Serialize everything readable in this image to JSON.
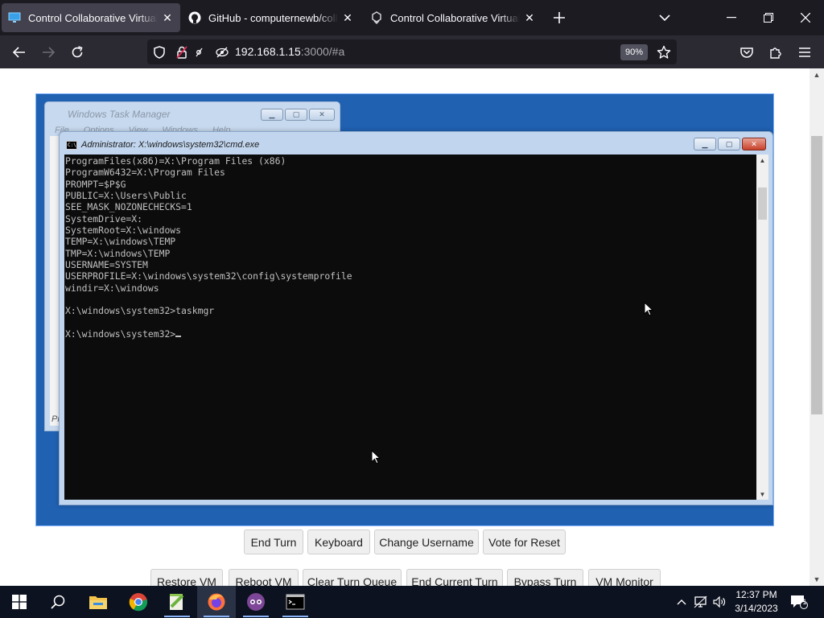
{
  "browser": {
    "tabs": [
      {
        "title": "Control Collaborative Virtual Machine",
        "icon": "monitor-icon",
        "active": true
      },
      {
        "title": "GitHub - computernewb/collab-vm",
        "icon": "github-icon",
        "active": false
      },
      {
        "title": "Control Collaborative Virtual Machine",
        "icon": "tab-extension-icon",
        "active": false
      }
    ],
    "url_host": "192.168.1.15",
    "url_path": ":3000/#a",
    "zoom": "90%"
  },
  "vm": {
    "task_manager": {
      "title": "Windows Task Manager",
      "menu": [
        "File",
        "Options",
        "View",
        "Windows",
        "Help"
      ],
      "status_fragment": "Pr"
    },
    "cmd": {
      "title": "Administrator: X:\\windows\\system32\\cmd.exe",
      "lines": [
        "ProgramFiles(x86)=X:\\Program Files (x86)",
        "ProgramW6432=X:\\Program Files",
        "PROMPT=$P$G",
        "PUBLIC=X:\\Users\\Public",
        "SEE_MASK_NOZONECHECKS=1",
        "SystemDrive=X:",
        "SystemRoot=X:\\windows",
        "TEMP=X:\\windows\\TEMP",
        "TMP=X:\\windows\\TEMP",
        "USERNAME=SYSTEM",
        "USERPROFILE=X:\\windows\\system32\\config\\systemprofile",
        "windir=X:\\windows",
        "",
        "X:\\windows\\system32>taskmgr",
        ""
      ],
      "prompt": "X:\\windows\\system32>"
    }
  },
  "controls": {
    "row1": [
      "End Turn",
      "Keyboard",
      "Change Username",
      "Vote for Reset"
    ],
    "row2": [
      "Restore VM",
      "Reboot VM",
      "Clear Turn Queue",
      "End Current Turn",
      "Bypass Turn",
      "VM Monitor"
    ]
  },
  "taskbar": {
    "apps": [
      "file-explorer-icon",
      "chrome-icon",
      "notepad-plus-plus-icon",
      "firefox-icon",
      "tor-browser-icon",
      "command-prompt-icon"
    ],
    "time": "12:37 PM",
    "date": "3/14/2023",
    "notification_count": "1"
  }
}
